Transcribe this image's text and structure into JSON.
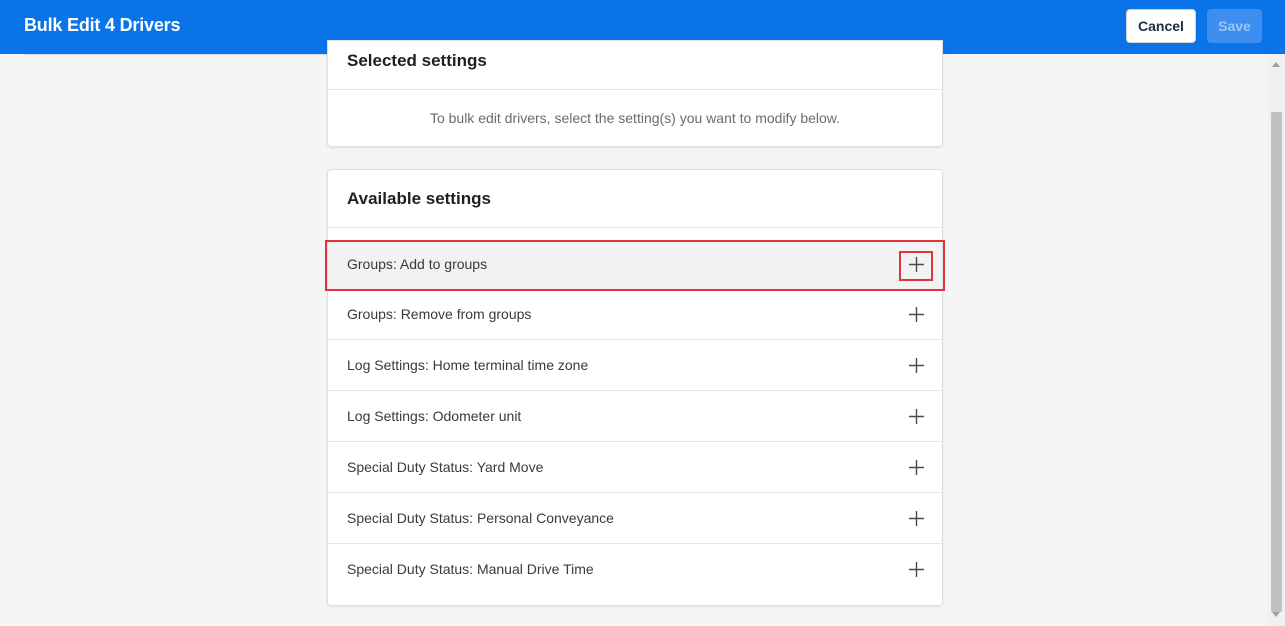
{
  "header": {
    "title": "Bulk Edit 4 Drivers",
    "cancel_label": "Cancel",
    "save_label": "Save"
  },
  "selected_settings": {
    "title": "Selected settings",
    "help_text": "To bulk edit drivers, select the setting(s) you want to modify below."
  },
  "available_settings": {
    "title": "Available settings",
    "items": [
      {
        "label": "Groups: Add to groups"
      },
      {
        "label": "Groups: Remove from groups"
      },
      {
        "label": "Log Settings: Home terminal time zone"
      },
      {
        "label": "Log Settings: Odometer unit"
      },
      {
        "label": "Special Duty Status: Yard Move"
      },
      {
        "label": "Special Duty Status: Personal Conveyance"
      },
      {
        "label": "Special Duty Status: Manual Drive Time"
      }
    ]
  },
  "colors": {
    "header_bg": "#0a73e8",
    "highlight_annotation": "#e0333a"
  },
  "icons": {
    "add": "plus-icon"
  }
}
